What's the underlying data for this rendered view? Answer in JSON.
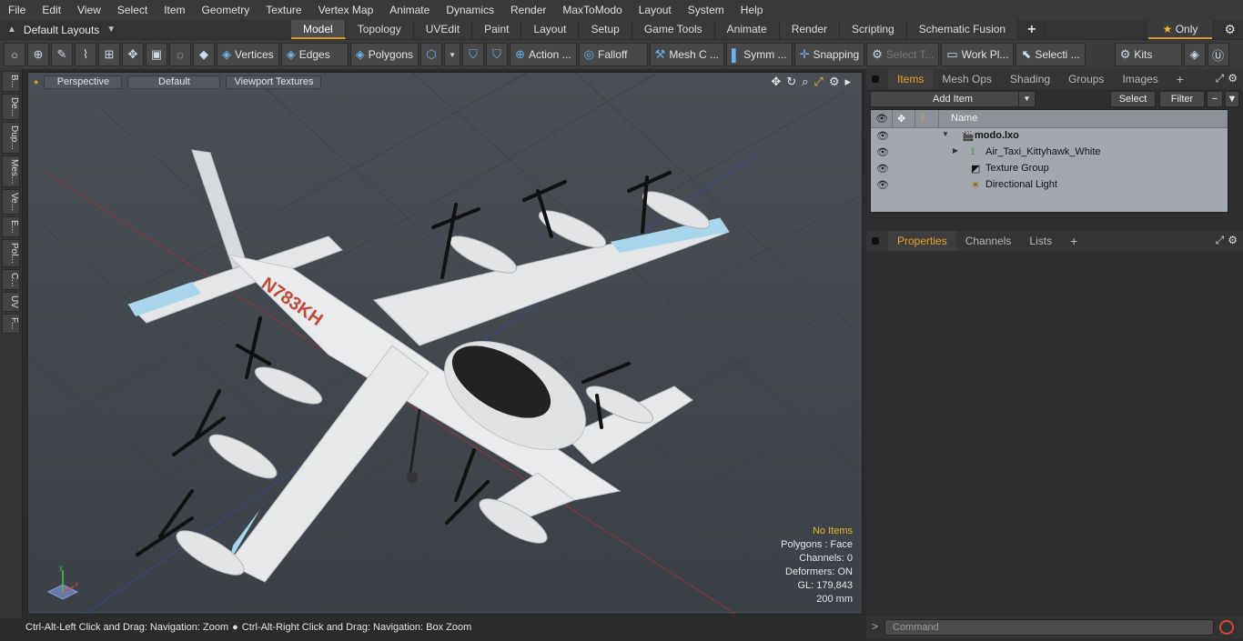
{
  "menu": [
    "File",
    "Edit",
    "View",
    "Select",
    "Item",
    "Geometry",
    "Texture",
    "Vertex Map",
    "Animate",
    "Dynamics",
    "Render",
    "MaxToModo",
    "Layout",
    "System",
    "Help"
  ],
  "layouts": {
    "label": "Default Layouts"
  },
  "tabs": [
    {
      "label": "Model",
      "active": true
    },
    {
      "label": "Topology"
    },
    {
      "label": "UVEdit"
    },
    {
      "label": "Paint"
    },
    {
      "label": "Layout"
    },
    {
      "label": "Setup"
    },
    {
      "label": "Game Tools"
    },
    {
      "label": "Animate"
    },
    {
      "label": "Render"
    },
    {
      "label": "Scripting"
    },
    {
      "label": "Schematic Fusion"
    }
  ],
  "only_label": "Only",
  "toolbar": {
    "vertices": "Vertices",
    "edges": "Edges",
    "polygons": "Polygons",
    "action": "Action ...",
    "falloff": "Falloff",
    "mesh": "Mesh C ...",
    "symm": "Symm ...",
    "snapping": "Snapping",
    "select_t": "Select T...",
    "workpl": "Work Pl...",
    "selecti": "Selecti ...",
    "kits": "Kits"
  },
  "side_tabs": [
    "B...",
    "De...",
    "Dup...",
    "Mes...",
    "Ve...",
    "E...",
    "Pol...",
    "C...",
    "UV",
    "F..."
  ],
  "viewport": {
    "perspective": "Perspective",
    "default": "Default",
    "textures": "Viewport Textures",
    "axis_neg_x": "-X",
    "axis_neg_z": "-Z"
  },
  "stats": {
    "no_items": "No Items",
    "polygons": "Polygons : Face",
    "channels": "Channels: 0",
    "deformers": "Deformers: ON",
    "gl": "GL: 179,843",
    "size": "200 mm"
  },
  "status": {
    "left": "Ctrl-Alt-Left Click and Drag: Navigation: Zoom",
    "right": "Ctrl-Alt-Right Click and Drag: Navigation: Box Zoom"
  },
  "items_panel": {
    "tabs": [
      "Items",
      "Mesh Ops",
      "Shading",
      "Groups",
      "Images"
    ],
    "add_item": "Add Item",
    "select": "Select",
    "filter": "Filter",
    "col_name": "Name",
    "rows": [
      {
        "label": "modo.lxo"
      },
      {
        "label": "Air_Taxi_Kittyhawk_White"
      },
      {
        "label": "Texture Group"
      },
      {
        "label": "Directional Light"
      }
    ]
  },
  "props_panel": {
    "tabs": [
      "Properties",
      "Channels",
      "Lists"
    ]
  },
  "command": {
    "placeholder": "Command"
  },
  "colors": {
    "accent": "#d89a2a",
    "viewport_bg": "#474c53",
    "list_bg": "#a2a8ae",
    "highlight": "#e8a232"
  }
}
